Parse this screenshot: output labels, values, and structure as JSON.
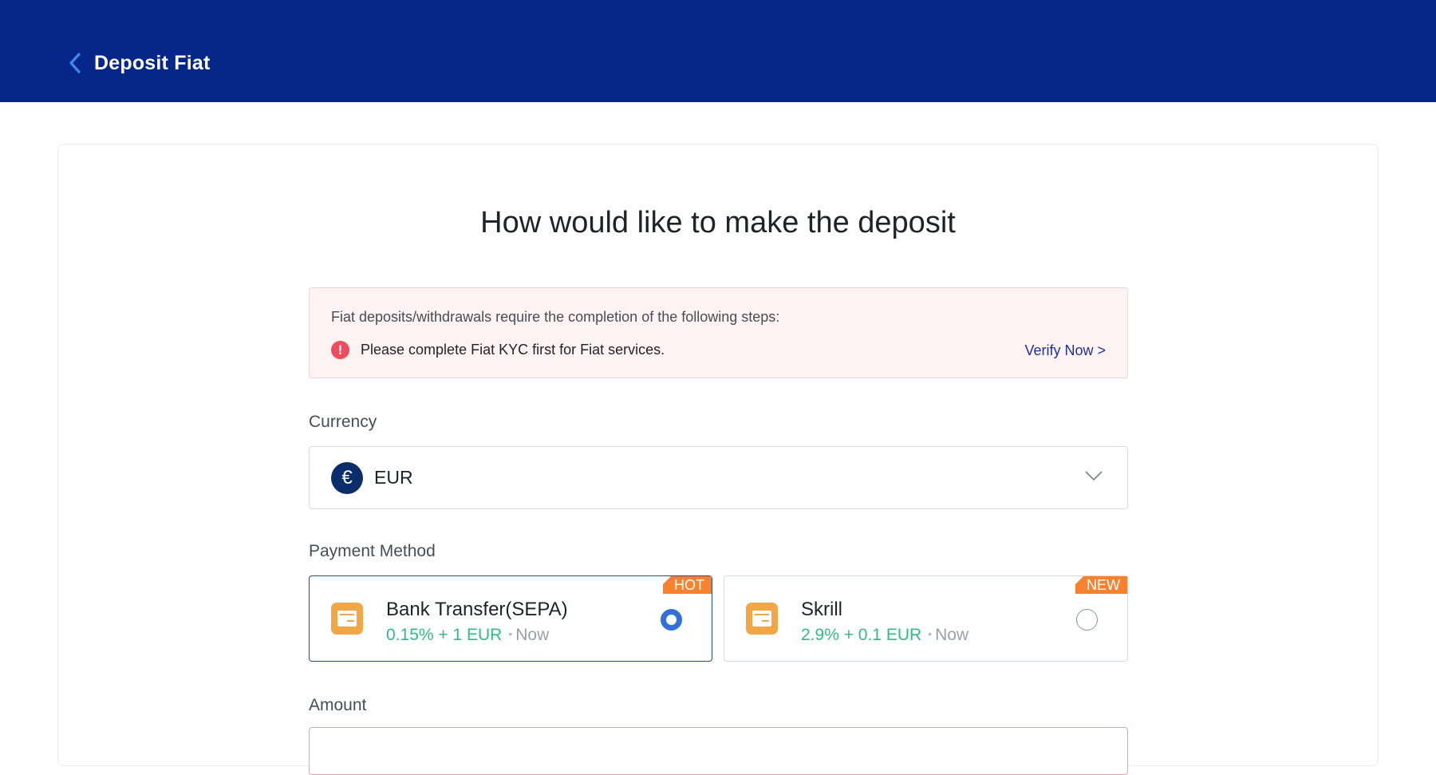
{
  "header": {
    "back_icon": "chevron-left-icon",
    "title": "Deposit Fiat"
  },
  "main": {
    "heading": "How would like to make the deposit",
    "notice": {
      "intro": "Fiat deposits/withdrawals require the completion of the following steps:",
      "icon": "exclamation-circle-icon",
      "step": "Please complete Fiat KYC first for Fiat services.",
      "verify_link": "Verify Now >"
    },
    "currency": {
      "label": "Currency",
      "icon": "euro-icon",
      "selected": "EUR",
      "symbol": "€"
    },
    "payment_method": {
      "label": "Payment Method",
      "options": [
        {
          "name": "Bank Transfer(SEPA)",
          "fee": "0.15% + 1 EUR",
          "separator": "•",
          "time": "Now",
          "badge": "HOT",
          "selected": true
        },
        {
          "name": "Skrill",
          "fee": "2.9% + 0.1 EUR",
          "separator": "•",
          "time": "Now",
          "badge": "NEW",
          "selected": false
        }
      ]
    },
    "amount": {
      "label": "Amount",
      "value": ""
    }
  },
  "colors": {
    "header_bg": "#06268a",
    "accent_blue": "#3270d8",
    "fee_green": "#2ebd85",
    "badge_orange": "#f7812e",
    "warn_red": "#ee4c5d"
  }
}
